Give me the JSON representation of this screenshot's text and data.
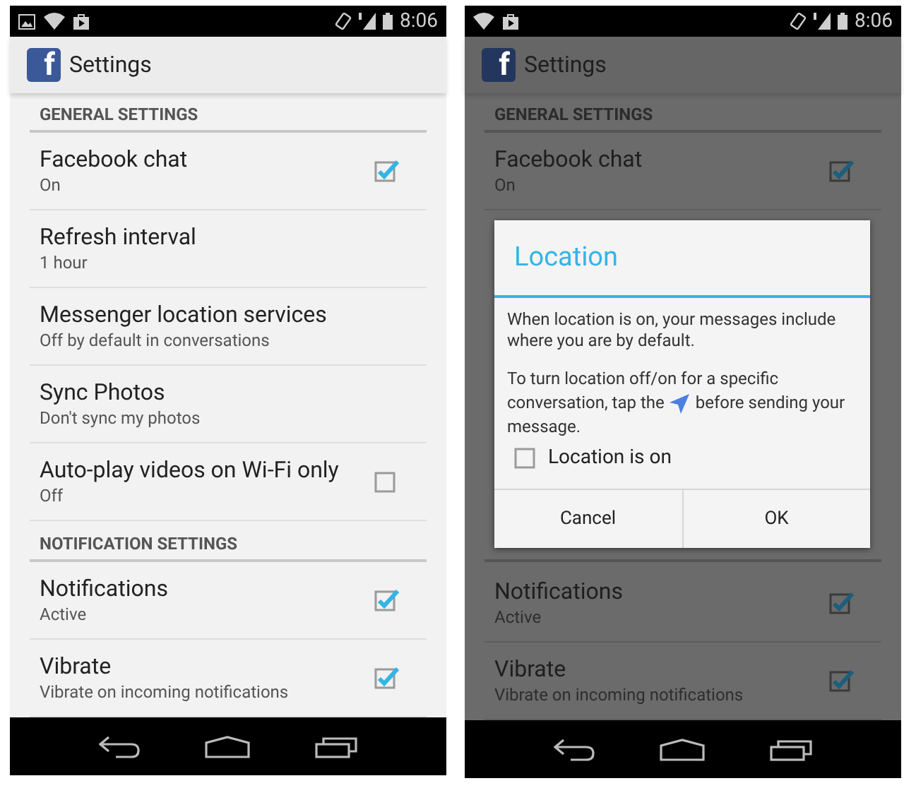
{
  "screens": [
    {
      "status_bar": {
        "time": "8:06",
        "show_picture_icon": true
      },
      "action_bar": {
        "logo_letter": "f",
        "title": "Settings"
      },
      "sections": [
        {
          "header": "GENERAL SETTINGS",
          "items": [
            {
              "kind": "checkbox",
              "title": "Facebook chat",
              "subtitle": "On",
              "checked": true
            },
            {
              "kind": "plain",
              "title": "Refresh interval",
              "subtitle": "1 hour"
            },
            {
              "kind": "plain",
              "title": "Messenger location services",
              "subtitle": "Off by default in conversations"
            },
            {
              "kind": "plain",
              "title": "Sync Photos",
              "subtitle": "Don't sync my photos"
            },
            {
              "kind": "checkbox",
              "title": "Auto-play videos on Wi-Fi only",
              "subtitle": "Off",
              "checked": false
            }
          ]
        },
        {
          "header": "NOTIFICATION SETTINGS",
          "items": [
            {
              "kind": "checkbox",
              "title": "Notifications",
              "subtitle": "Active",
              "checked": true
            },
            {
              "kind": "checkbox",
              "title": "Vibrate",
              "subtitle": "Vibrate on incoming notifications",
              "checked": true
            }
          ]
        }
      ]
    },
    {
      "status_bar": {
        "time": "8:06",
        "show_picture_icon": false
      },
      "action_bar": {
        "logo_letter": "f",
        "title": "Settings"
      },
      "sections": [
        {
          "header": "GENERAL SETTINGS",
          "items": [
            {
              "kind": "checkbox",
              "title": "Facebook chat",
              "subtitle": "On",
              "checked": true
            }
          ]
        },
        {
          "items": [
            {
              "kind": "checkbox",
              "title": "Notifications",
              "subtitle": "Active",
              "checked": true
            },
            {
              "kind": "checkbox",
              "title": "Vibrate",
              "subtitle": "Vibrate on incoming notifications",
              "checked": true
            }
          ]
        }
      ],
      "dialog": {
        "title": "Location",
        "paragraph_1": "When location is on, your messages include where you are by default.",
        "paragraph_2_line_1": "To turn location off/on for a specific",
        "paragraph_2_line_2_before_icon": "conversation, tap the",
        "paragraph_2_line_2_after_icon": "before sending your",
        "paragraph_2_line_3": "message.",
        "checkbox": {
          "label": "Location is on",
          "checked": false
        },
        "buttons": [
          "Cancel",
          "OK"
        ]
      }
    }
  ]
}
